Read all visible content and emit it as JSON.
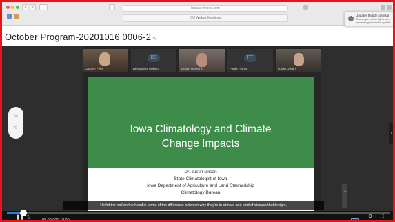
{
  "browser": {
    "address": "iastate.webex.com",
    "tab_title": "ISU Webex Meetings",
    "notification": {
      "title": "Updates Ready to Install",
      "body": "Some apps currently in use, preventing automatic update."
    }
  },
  "page": {
    "title": "October Program-20201016 0006-2"
  },
  "gallery": [
    {
      "name": "Carolyn Pries",
      "initials": ""
    },
    {
      "name": "Bernadette Hebert",
      "initials": "BS"
    },
    {
      "name": "Linda Hepworth",
      "initials": ""
    },
    {
      "name": "Paula Flores",
      "initials": "PT"
    },
    {
      "name": "Justin Glisan",
      "initials": ""
    }
  ],
  "slide": {
    "title_line1": "Iowa Climatology and Climate",
    "title_line2": "Change Impacts",
    "presenter": "Dr. Justin Glisan",
    "line2": "State Climatologist of Iowa",
    "line3": "Iowa Department of Agriculture and Land Stewardship",
    "line4": "Climatology Bureau"
  },
  "caption": "He hit the nail on the head in terms of the difference between why they're in climate and kind of discuss that tonight.",
  "player": {
    "current_time": "03:03",
    "duration": "01:10:05",
    "progress_fraction": 0.044,
    "time_separator": " / ",
    "cc_label": "CC",
    "volume_label": "1.0x"
  },
  "colors": {
    "frame": "#e8141b",
    "slide_green": "#3d8c4a",
    "progress_accent": "#2a7de1"
  }
}
